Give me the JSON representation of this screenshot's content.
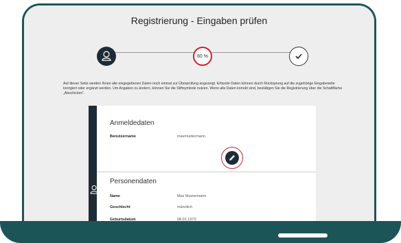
{
  "page": {
    "title": "Registrierung - Eingaben prüfen",
    "instructions": "Auf dieser Seite werden Ihnen alle eingegebenen Daten noch einmal zur Überprüfung angezeigt. Erfasste Daten können durch Rücksprung auf die zugehörige Eingabeseite korrigiert oder ergänzt werden. Um Angaben zu ändern, können Sie die Stiftsymbole nutzen. Wenn alle Daten korrekt sind, bestätigen Sie die Registrierung über die Schaltfläche „Abschicken“."
  },
  "progress": {
    "value": 0.8,
    "label": "80 %",
    "steps": [
      {
        "icon": "user-icon"
      },
      {
        "icon": "percent-indicator"
      },
      {
        "icon": "checkmark-icon"
      }
    ]
  },
  "sections": [
    {
      "title": "Anmeldedaten",
      "fields": [
        {
          "label": "Benutzername",
          "value": "maxmustermann"
        }
      ]
    },
    {
      "title": "Personendaten",
      "fields": [
        {
          "label": "Name",
          "value": "Max Mustermann"
        },
        {
          "label": "Geschlecht",
          "value": "männlich"
        },
        {
          "label": "Geburtsdatum",
          "value": "08.01.1970"
        }
      ]
    }
  ],
  "colors": {
    "frame": "#1c5558",
    "accent_red": "#d11f2a",
    "dark": "#1d2b36",
    "background": "#eeeeee"
  },
  "icons": {
    "edit": "pencil-icon",
    "side": "user-outline-icon"
  }
}
